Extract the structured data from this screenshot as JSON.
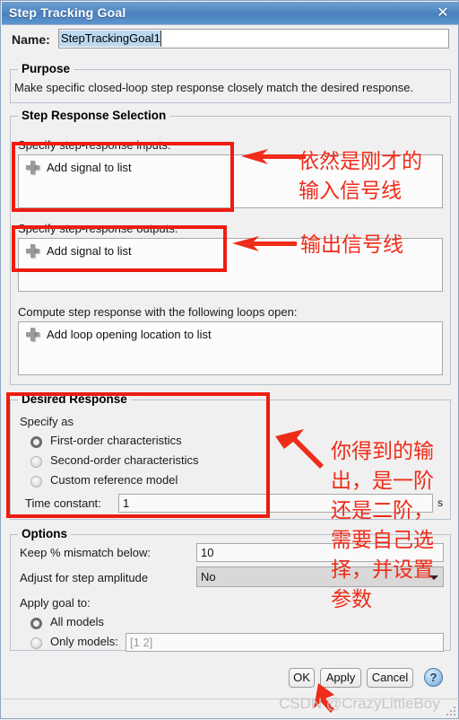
{
  "window": {
    "title": "Step Tracking Goal",
    "close_icon": "close-icon"
  },
  "name_field": {
    "label": "Name:",
    "value": "StepTrackingGoal1"
  },
  "purpose": {
    "title": "Purpose",
    "text": "Make specific closed-loop step response closely match the desired response."
  },
  "step_response_selection": {
    "title": "Step Response Selection",
    "inputs_label": "Specify step-response inputs:",
    "inputs_add": "Add signal to list",
    "outputs_label": "Specify step-response outputs:",
    "outputs_add": "Add signal to list",
    "loops_label": "Compute step response with the following loops open:",
    "loops_add": "Add loop opening location to list"
  },
  "desired_response": {
    "title": "Desired Response",
    "specify_as_label": "Specify as",
    "options": [
      {
        "label": "First-order characteristics",
        "selected": true
      },
      {
        "label": "Second-order characteristics",
        "selected": false
      },
      {
        "label": "Custom reference model",
        "selected": false
      }
    ],
    "time_constant_label": "Time constant:",
    "time_constant_value": "1",
    "time_constant_unit": "s"
  },
  "options": {
    "title": "Options",
    "mismatch_label": "Keep % mismatch below:",
    "mismatch_value": "10",
    "adjust_label": "Adjust for step amplitude",
    "adjust_value": "No",
    "apply_goal_label": "Apply goal to:",
    "apply_options": [
      {
        "label": "All models",
        "selected": true
      },
      {
        "label": "Only models:",
        "selected": false
      }
    ],
    "only_models_placeholder": "[1 2]"
  },
  "buttons": {
    "ok": "OK",
    "apply": "Apply",
    "cancel": "Cancel",
    "help": "?"
  },
  "annotations": {
    "note_inputs": "依然是刚才的\n输入信号线",
    "note_outputs": "输出信号线",
    "note_desired": "你得到的输\n出，是一阶\n还是二阶，\n需要自己选\n择，并设置\n参数",
    "watermark": "CSDN @CrazyLittleBoy",
    "accent_red": "#ee1c11"
  }
}
